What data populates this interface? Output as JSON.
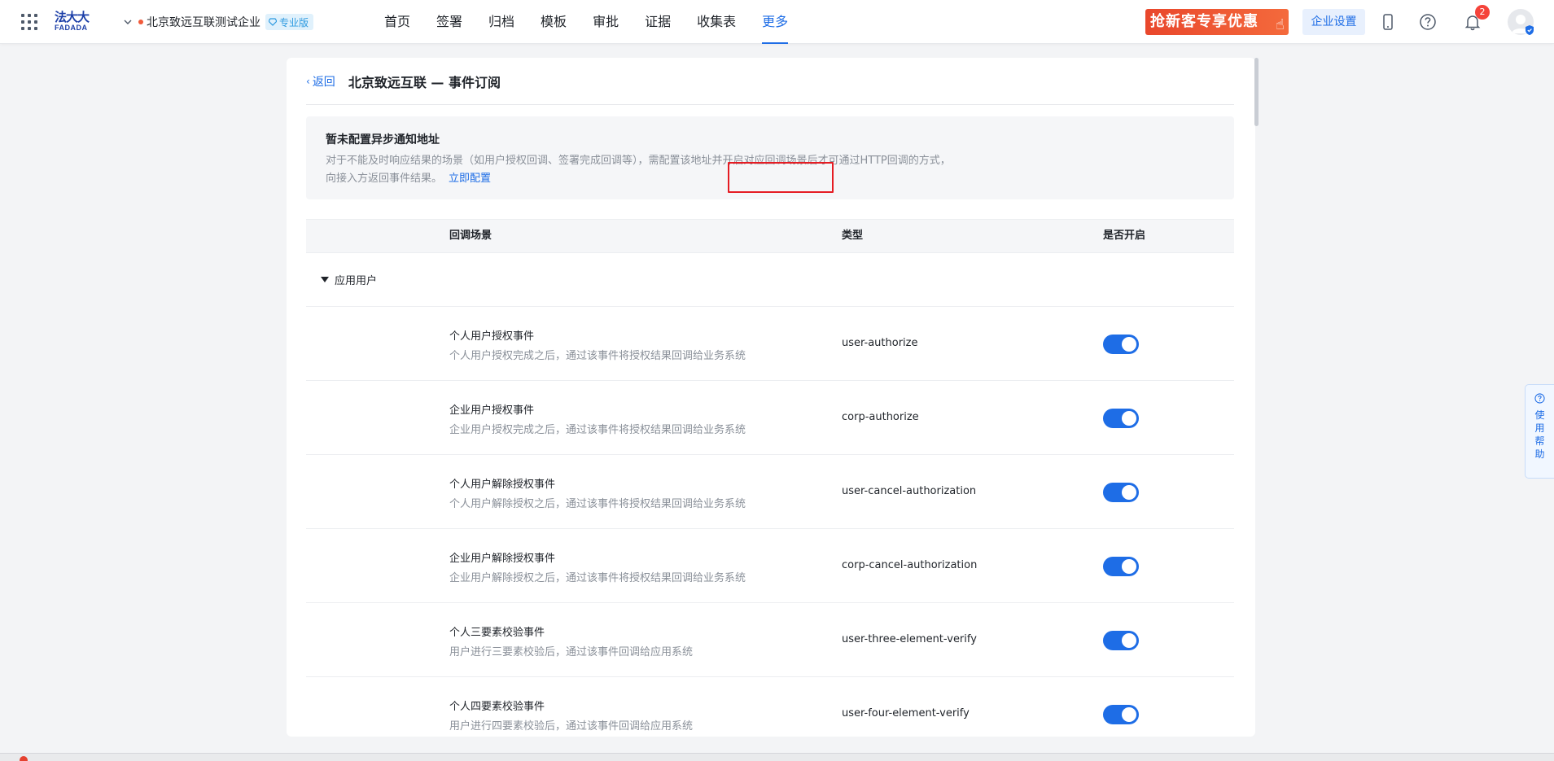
{
  "topbar": {
    "logo_cn": "法大大",
    "logo_en": "FADADA",
    "org_name": "北京致远互联测试企业",
    "org_badge": "专业版",
    "nav": [
      "首页",
      "签署",
      "归档",
      "模板",
      "审批",
      "证据",
      "收集表",
      "更多"
    ],
    "active_nav": "更多",
    "promo": "抢新客专享优惠",
    "corp_settings": "企业设置",
    "notification_count": "2"
  },
  "page": {
    "back": "返回",
    "title": "北京致远互联 — 事件订阅"
  },
  "notice": {
    "title": "暂未配置异步通知地址",
    "desc_line1": "对于不能及时响应结果的场景（如用户授权回调、签署完成回调等），需配置该地址并开启对应回调场景后才可通过HTTP回调的方式，",
    "desc_line2": "向接入方返回事件结果。",
    "config_link": "立即配置"
  },
  "table": {
    "columns": [
      "回调场景",
      "类型",
      "是否开启"
    ],
    "group": "应用用户",
    "rows": [
      {
        "title": "个人用户授权事件",
        "desc": "个人用户授权完成之后，通过该事件将授权结果回调给业务系统",
        "type": "user-authorize",
        "enabled": true
      },
      {
        "title": "企业用户授权事件",
        "desc": "企业用户授权完成之后，通过该事件将授权结果回调给业务系统",
        "type": "corp-authorize",
        "enabled": true
      },
      {
        "title": "个人用户解除授权事件",
        "desc": "个人用户解除授权之后，通过该事件将授权结果回调给业务系统",
        "type": "user-cancel-authorization",
        "enabled": true
      },
      {
        "title": "企业用户解除授权事件",
        "desc": "企业用户解除授权之后，通过该事件将授权结果回调给业务系统",
        "type": "corp-cancel-authorization",
        "enabled": true
      },
      {
        "title": "个人三要素校验事件",
        "desc": "用户进行三要素校验后，通过该事件回调给应用系统",
        "type": "user-three-element-verify",
        "enabled": true
      },
      {
        "title": "个人四要素校验事件",
        "desc": "用户进行四要素校验后，通过该事件回调给应用系统",
        "type": "user-four-element-verify",
        "enabled": true
      }
    ]
  },
  "help": {
    "label": "使用帮助"
  },
  "colors": {
    "accent": "#1e6de6",
    "promo": "#e9472c",
    "highlight_box": "#e51c23"
  }
}
